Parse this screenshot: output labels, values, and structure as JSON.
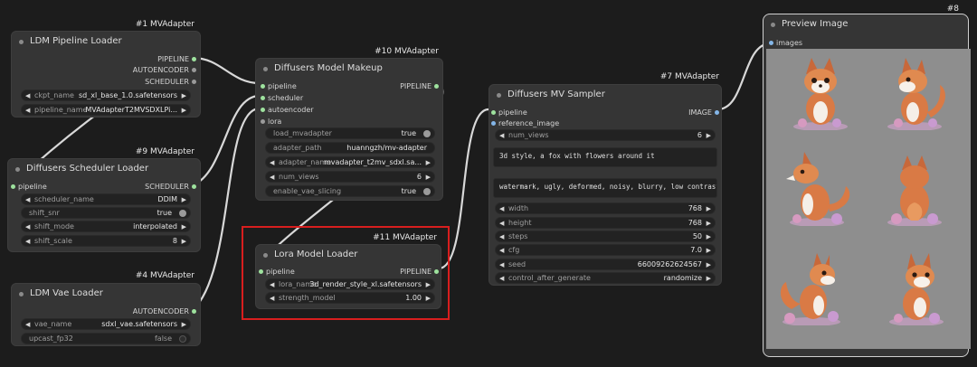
{
  "nodes": {
    "ldm_pipeline_loader": {
      "tag": "#1 MVAdapter",
      "title": "LDM Pipeline Loader",
      "outputs": [
        "PIPELINE",
        "AUTOENCODER",
        "SCHEDULER"
      ],
      "widgets": [
        {
          "label": "ckpt_name",
          "value": "sd_xl_base_1.0.safetensors"
        },
        {
          "label": "pipeline_name",
          "value": "MVAdapterT2MVSDXLPi..."
        }
      ]
    },
    "diffusers_model_makeup": {
      "tag": "#10 MVAdapter",
      "title": "Diffusers Model Makeup",
      "inputs": [
        "pipeline",
        "scheduler",
        "autoencoder",
        "lora"
      ],
      "output": "PIPELINE",
      "widgets": [
        {
          "label": "load_mvadapter",
          "value": "true"
        },
        {
          "label": "adapter_path",
          "value": "huanngzh/mv-adapter"
        },
        {
          "label": "adapter_name",
          "value": "mvadapter_t2mv_sdxl.sa..."
        },
        {
          "label": "num_views",
          "value": "6"
        },
        {
          "label": "enable_vae_slicing",
          "value": "true"
        }
      ]
    },
    "diffusers_scheduler_loader": {
      "tag": "#9 MVAdapter",
      "title": "Diffusers Scheduler Loader",
      "input": "pipeline",
      "output": "SCHEDULER",
      "widgets": [
        {
          "label": "scheduler_name",
          "value": "DDIM"
        },
        {
          "label": "shift_snr",
          "value": "true"
        },
        {
          "label": "shift_mode",
          "value": "interpolated"
        },
        {
          "label": "shift_scale",
          "value": "8"
        }
      ]
    },
    "ldm_vae_loader": {
      "tag": "#4 MVAdapter",
      "title": "LDM Vae Loader",
      "output": "AUTOENCODER",
      "widgets": [
        {
          "label": "vae_name",
          "value": "sdxl_vae.safetensors"
        },
        {
          "label": "upcast_fp32",
          "value": "false"
        }
      ]
    },
    "lora_model_loader": {
      "tag": "#11 MVAdapter",
      "title": "Lora Model Loader",
      "input": "pipeline",
      "output": "PIPELINE",
      "widgets": [
        {
          "label": "lora_name",
          "value": "3d_render_style_xl.safetensors"
        },
        {
          "label": "strength_model",
          "value": "1.00"
        }
      ]
    },
    "diffusers_mv_sampler": {
      "tag": "#7 MVAdapter",
      "title": "Diffusers MV Sampler",
      "inputs": [
        "pipeline",
        "reference_image"
      ],
      "output": "IMAGE",
      "num_views": {
        "label": "num_views",
        "value": "6"
      },
      "prompt": "3d style, a fox with flowers around it",
      "negative_prompt": "watermark, ugly, deformed, noisy, blurry, low contrast",
      "widgets": [
        {
          "label": "width",
          "value": "768"
        },
        {
          "label": "height",
          "value": "768"
        },
        {
          "label": "steps",
          "value": "50"
        },
        {
          "label": "cfg",
          "value": "7.0"
        },
        {
          "label": "seed",
          "value": "66009262624567"
        },
        {
          "label": "control_after_generate",
          "value": "randomize"
        }
      ]
    },
    "preview_image": {
      "tag": "#8",
      "title": "Preview Image",
      "input": "images"
    }
  },
  "colors": {
    "canvas": "#1c1c1c",
    "node": "#353535",
    "widget": "#222222",
    "pipeline_port": "#9ee29e",
    "image_port": "#84b6e8",
    "highlight": "#d81e1e",
    "wire": "#d8d8d8"
  }
}
